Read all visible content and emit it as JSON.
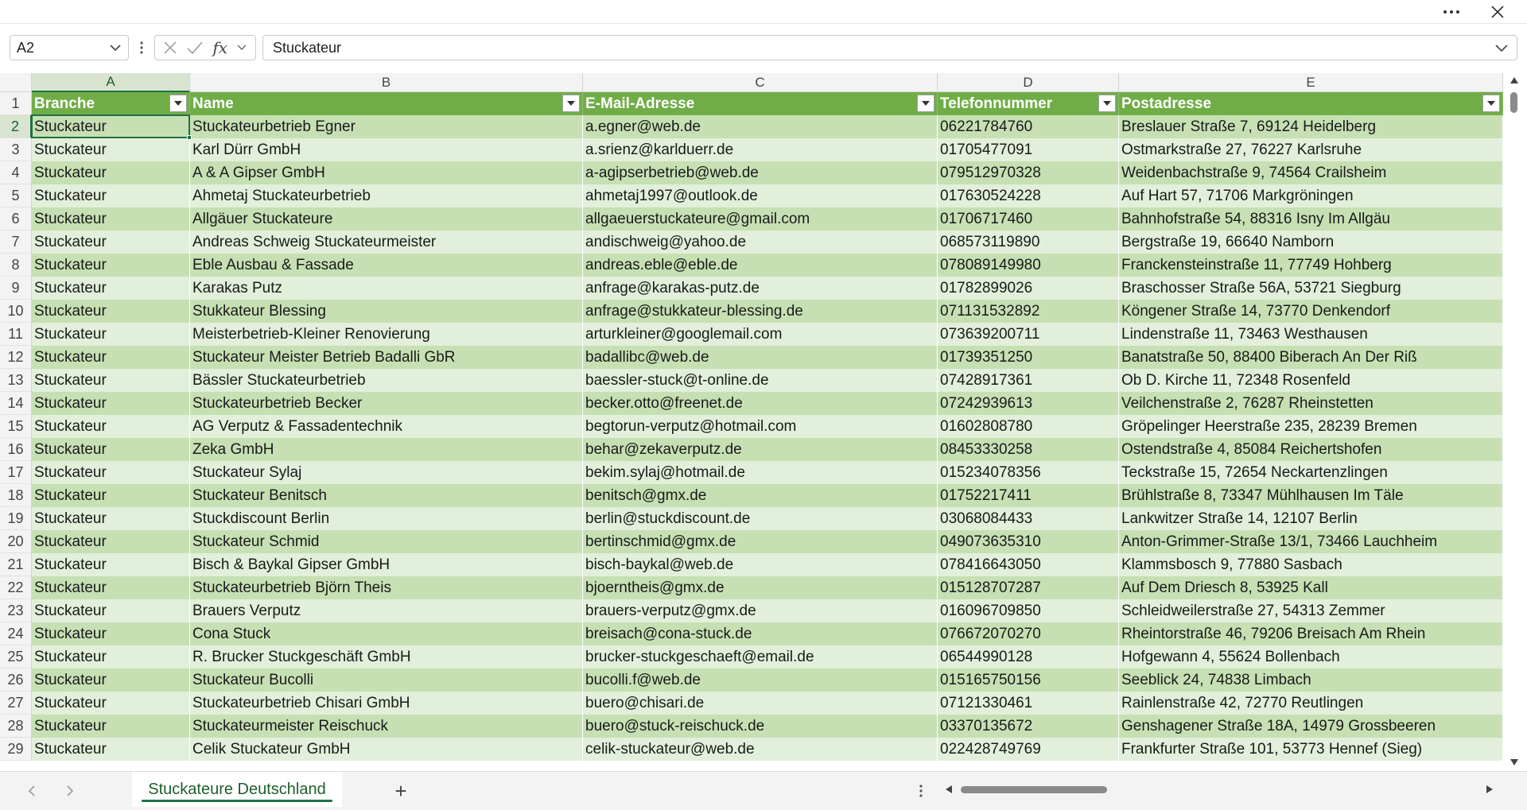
{
  "titlebar": {
    "more_icon": "more-horizontal-icon",
    "close_icon": "close-icon"
  },
  "formula_bar": {
    "name_box": "A2",
    "value": "Stuckateur",
    "fx_label": "fx"
  },
  "columns": [
    "A",
    "B",
    "C",
    "D",
    "E"
  ],
  "table": {
    "headers": [
      "Branche",
      "Name",
      "E-Mail-Adresse",
      "Telefonnummer",
      "Postadresse"
    ],
    "rows": [
      {
        "num": "2",
        "cells": [
          "Stuckateur",
          "Stuckateurbetrieb Egner",
          "a.egner@web.de",
          "06221784760",
          "Breslauer Straße 7, 69124 Heidelberg"
        ]
      },
      {
        "num": "3",
        "cells": [
          "Stuckateur",
          "Karl Dürr GmbH",
          "a.srienz@karlduerr.de",
          "01705477091",
          "Ostmarkstraße 27, 76227 Karlsruhe"
        ]
      },
      {
        "num": "4",
        "cells": [
          "Stuckateur",
          "A & A Gipser GmbH",
          "a-agipserbetrieb@web.de",
          "079512970328",
          "Weidenbachstraße 9, 74564 Crailsheim"
        ]
      },
      {
        "num": "5",
        "cells": [
          "Stuckateur",
          "Ahmetaj Stuckateurbetrieb",
          "ahmetaj1997@outlook.de",
          "017630524228",
          "Auf Hart 57, 71706 Markgröningen"
        ]
      },
      {
        "num": "6",
        "cells": [
          "Stuckateur",
          "Allgäuer Stuckateure",
          "allgaeuerstuckateure@gmail.com",
          "01706717460",
          "Bahnhofstraße 54, 88316 Isny Im Allgäu"
        ]
      },
      {
        "num": "7",
        "cells": [
          "Stuckateur",
          "Andreas Schweig Stuckateurmeister",
          "andischweig@yahoo.de",
          "068573119890",
          "Bergstraße 19, 66640 Namborn"
        ]
      },
      {
        "num": "8",
        "cells": [
          "Stuckateur",
          "Eble Ausbau & Fassade",
          "andreas.eble@eble.de",
          "078089149980",
          "Franckensteinstraße 11, 77749 Hohberg"
        ]
      },
      {
        "num": "9",
        "cells": [
          "Stuckateur",
          "Karakas Putz",
          "anfrage@karakas-putz.de",
          "01782899026",
          "Braschosser Straße 56A, 53721 Siegburg"
        ]
      },
      {
        "num": "10",
        "cells": [
          "Stuckateur",
          "Stukkateur Blessing",
          "anfrage@stukkateur-blessing.de",
          "071131532892",
          "Köngener Straße 14, 73770 Denkendorf"
        ]
      },
      {
        "num": "11",
        "cells": [
          "Stuckateur",
          "Meisterbetrieb-Kleiner Renovierung",
          "arturkleiner@googlemail.com",
          "073639200711",
          "Lindenstraße 11, 73463 Westhausen"
        ]
      },
      {
        "num": "12",
        "cells": [
          "Stuckateur",
          "Stuckateur Meister Betrieb Badalli GbR",
          "badallibc@web.de",
          "01739351250",
          "Banatstraße 50, 88400 Biberach An Der Riß"
        ]
      },
      {
        "num": "13",
        "cells": [
          "Stuckateur",
          "Bässler Stuckateurbetrieb",
          "baessler-stuck@t-online.de",
          "07428917361",
          "Ob D. Kirche 11, 72348 Rosenfeld"
        ]
      },
      {
        "num": "14",
        "cells": [
          "Stuckateur",
          "Stuckateurbetrieb Becker",
          "becker.otto@freenet.de",
          "07242939613",
          "Veilchenstraße 2, 76287 Rheinstetten"
        ]
      },
      {
        "num": "15",
        "cells": [
          "Stuckateur",
          "AG Verputz & Fassadentechnik",
          "begtorun-verputz@hotmail.com",
          "01602808780",
          "Gröpelinger Heerstraße 235, 28239 Bremen"
        ]
      },
      {
        "num": "16",
        "cells": [
          "Stuckateur",
          "Zeka GmbH",
          "behar@zekaverputz.de",
          "08453330258",
          "Ostendstraße 4, 85084 Reichertshofen"
        ]
      },
      {
        "num": "17",
        "cells": [
          "Stuckateur",
          "Stuckateur Sylaj",
          "bekim.sylaj@hotmail.de",
          "015234078356",
          "Teckstraße 15, 72654 Neckartenzlingen"
        ]
      },
      {
        "num": "18",
        "cells": [
          "Stuckateur",
          "Stuckateur Benitsch",
          "benitsch@gmx.de",
          "01752217411",
          "Brühlstraße 8, 73347 Mühlhausen Im Täle"
        ]
      },
      {
        "num": "19",
        "cells": [
          "Stuckateur",
          "Stuckdiscount Berlin",
          "berlin@stuckdiscount.de",
          "03068084433",
          "Lankwitzer Straße 14, 12107 Berlin"
        ]
      },
      {
        "num": "20",
        "cells": [
          "Stuckateur",
          "Stuckateur Schmid",
          "bertinschmid@gmx.de",
          "049073635310",
          "Anton-Grimmer-Straße 13/1, 73466 Lauchheim"
        ]
      },
      {
        "num": "21",
        "cells": [
          "Stuckateur",
          "Bisch & Baykal Gipser GmbH",
          "bisch-baykal@web.de",
          "078416643050",
          "Klammsbosch 9, 77880 Sasbach"
        ]
      },
      {
        "num": "22",
        "cells": [
          "Stuckateur",
          "Stuckateurbetrieb Björn Theis",
          "bjoerntheis@gmx.de",
          "015128707287",
          "Auf Dem Driesch 8, 53925 Kall"
        ]
      },
      {
        "num": "23",
        "cells": [
          "Stuckateur",
          "Brauers Verputz",
          "brauers-verputz@gmx.de",
          "016096709850",
          "Schleidweilerstraße 27, 54313 Zemmer"
        ]
      },
      {
        "num": "24",
        "cells": [
          "Stuckateur",
          "Cona Stuck",
          "breisach@cona-stuck.de",
          "076672070270",
          "Rheintorstraße 46, 79206 Breisach Am Rhein"
        ]
      },
      {
        "num": "25",
        "cells": [
          "Stuckateur",
          "R. Brucker Stuckgeschäft GmbH",
          "brucker-stuckgeschaeft@email.de",
          "06544990128",
          "Hofgewann 4, 55624 Bollenbach"
        ]
      },
      {
        "num": "26",
        "cells": [
          "Stuckateur",
          "Stuckateur Bucolli",
          "bucolli.f@web.de",
          "015165750156",
          "Seeblick 24, 74838 Limbach"
        ]
      },
      {
        "num": "27",
        "cells": [
          "Stuckateur",
          "Stuckateurbetrieb Chisari GmbH",
          "buero@chisari.de",
          "07121330461",
          "Rainlenstraße 42, 72770 Reutlingen"
        ]
      },
      {
        "num": "28",
        "cells": [
          "Stuckateur",
          "Stuckateurmeister Reischuck",
          "buero@stuck-reischuck.de",
          "03370135672",
          "Genshagener Straße 18A, 14979 Grossbeeren"
        ]
      },
      {
        "num": "29",
        "cells": [
          "Stuckateur",
          "Celik Stuckateur GmbH",
          "celik-stuckateur@web.de",
          "022428749769",
          "Frankfurter Straße 101, 53773 Hennef (Sieg)"
        ]
      }
    ]
  },
  "sheet_tabs": {
    "active": "Stuckateure Deutschland",
    "add_label": "+"
  },
  "colors": {
    "header_green": "#70ad47",
    "band_dark": "#c6e0b4",
    "band_light": "#e2efda",
    "accent": "#1e7145"
  }
}
